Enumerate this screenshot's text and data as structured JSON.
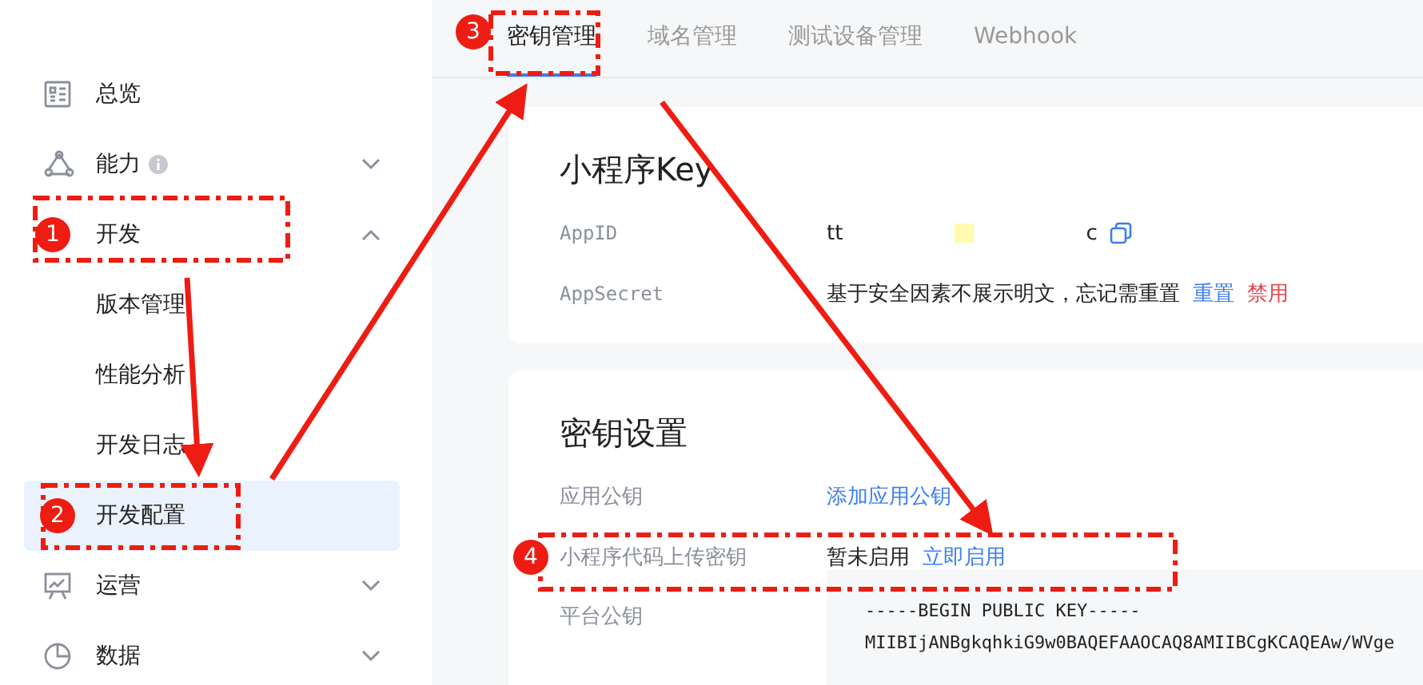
{
  "sidebar": {
    "items": [
      {
        "label": "总览",
        "selected": false
      },
      {
        "label": "能力",
        "info": true,
        "expanded": false,
        "selected": false
      },
      {
        "label": "开发",
        "expanded": true,
        "selected": false,
        "children": [
          {
            "label": "版本管理",
            "selected": false
          },
          {
            "label": "性能分析",
            "selected": false
          },
          {
            "label": "开发日志",
            "selected": false
          },
          {
            "label": "开发配置",
            "selected": true
          }
        ]
      },
      {
        "label": "运营",
        "expanded": false,
        "selected": false
      },
      {
        "label": "数据",
        "expanded": false,
        "selected": false
      }
    ]
  },
  "tabs": [
    {
      "label": "密钥管理",
      "selected": true
    },
    {
      "label": "域名管理",
      "selected": false
    },
    {
      "label": "测试设备管理",
      "selected": false
    },
    {
      "label": "Webhook",
      "selected": false
    }
  ],
  "key_card": {
    "title": "小程序Key",
    "rows": [
      {
        "label": "AppID",
        "kind": "appid",
        "value_start": "tt",
        "value_end": "c"
      },
      {
        "label": "AppSecret",
        "kind": "text",
        "text": "基于安全因素不展示明文，忘记需重置",
        "links": [
          {
            "label": "重置",
            "kind": "primary"
          },
          {
            "label": "禁用",
            "kind": "danger"
          }
        ]
      }
    ]
  },
  "settings_card": {
    "title": "密钥设置",
    "rows": [
      {
        "label": "应用公钥",
        "kind": "text",
        "links": [
          {
            "label": "添加应用公钥",
            "kind": "primary"
          }
        ]
      },
      {
        "label": "小程序代码上传密钥",
        "kind": "text",
        "text": "暂未启用",
        "links": [
          {
            "label": "立即启用",
            "kind": "primary"
          }
        ]
      },
      {
        "label": "平台公钥",
        "kind": "code",
        "lines": [
          "-----BEGIN PUBLIC KEY-----",
          "MIIBIjANBgkqhkiG9w0BAQEFAAOCAQ8AMIIBCgKCAQEAw/WVge"
        ]
      }
    ]
  },
  "annotations": [
    {
      "number": "1"
    },
    {
      "number": "2"
    },
    {
      "number": "3"
    },
    {
      "number": "4"
    }
  ]
}
